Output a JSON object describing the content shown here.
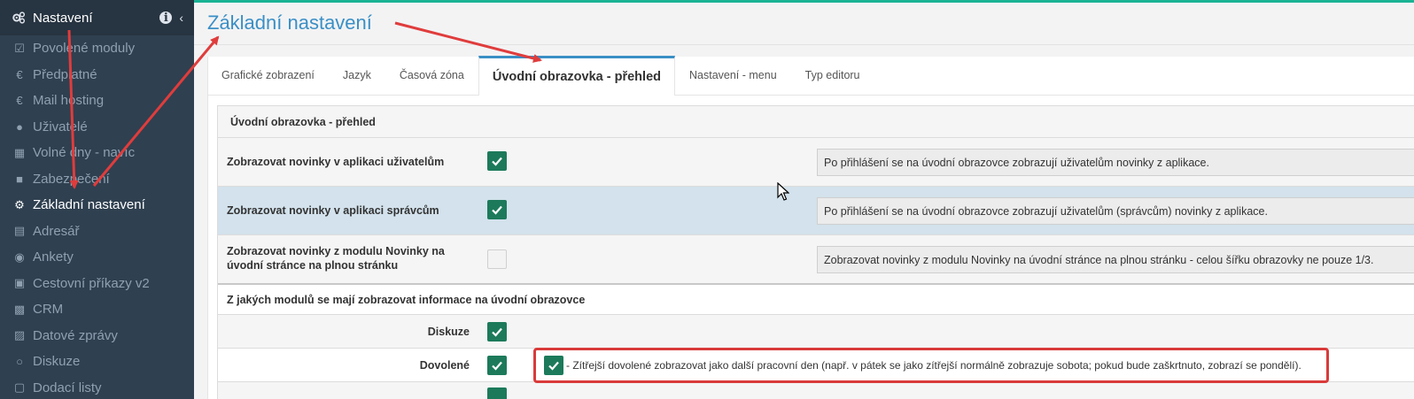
{
  "sidebar": {
    "header": {
      "label": "Nastavení",
      "icon": "gears-icon"
    },
    "items": [
      {
        "label": "Povolené moduly",
        "icon": "check-square-icon"
      },
      {
        "label": "Předplatné",
        "icon": "euro-icon"
      },
      {
        "label": "Mail hosting",
        "icon": "euro-icon"
      },
      {
        "label": "Uživatelé",
        "icon": "users-icon"
      },
      {
        "label": "Volné dny - navíc",
        "icon": "calendar-icon"
      },
      {
        "label": "Zabezpečení",
        "icon": "lock-icon"
      },
      {
        "label": "Základní nastavení",
        "icon": "gears-icon",
        "active": true
      },
      {
        "label": "Adresář",
        "icon": "book-icon"
      },
      {
        "label": "Ankety",
        "icon": "bullseye-icon"
      },
      {
        "label": "Cestovní příkazy v2",
        "icon": "bus-icon"
      },
      {
        "label": "CRM",
        "icon": "building-icon"
      },
      {
        "label": "Datové zprávy",
        "icon": "inbox-icon"
      },
      {
        "label": "Diskuze",
        "icon": "comments-icon"
      },
      {
        "label": "Dodací listy",
        "icon": "truck-icon"
      }
    ]
  },
  "page": {
    "title": "Základní nastavení"
  },
  "tabs": [
    {
      "label": "Grafické zobrazení"
    },
    {
      "label": "Jazyk"
    },
    {
      "label": "Časová zóna"
    },
    {
      "label": "Úvodní obrazovka - přehled",
      "active": true
    },
    {
      "label": "Nastavení - menu"
    },
    {
      "label": "Typ editoru"
    }
  ],
  "panel": {
    "title": "Úvodní obrazovka - přehled",
    "rows": [
      {
        "label": "Zobrazovat novinky v aplikaci uživatelům",
        "checked": true,
        "description": "Po přihlášení se na úvodní obrazovce zobrazují uživatelům novinky z aplikace."
      },
      {
        "label": "Zobrazovat novinky v aplikaci správcům",
        "checked": true,
        "description": "Po přihlášení se na úvodní obrazovce zobrazují uživatelům (správcům) novinky z aplikace."
      },
      {
        "label_line1": "Zobrazovat novinky z modulu Novinky na",
        "label_line2": "úvodní stránce na plnou stránku",
        "checked": false,
        "description": "Zobrazovat novinky z modulu Novinky na úvodní stránce na plnou stránku - celou šířku obrazovky ne pouze 1/3."
      }
    ],
    "modules_title": "Z jakých modulů se mají zobrazovat informace na úvodní obrazovce",
    "modules": [
      {
        "label": "Diskuze",
        "checked": true
      },
      {
        "label": "Dovolené",
        "checked": true,
        "extra": "- Zítřejší dovolené zobrazovat jako další pracovní den (např. v pátek se jako zítřejší normálně zobrazuje sobota; pokud bude zaškrtnuto, zobrazí se pondělí).",
        "extra_checked": true
      }
    ]
  },
  "colors": {
    "sidebar": "#2f4050",
    "accent": "#3a8fc6",
    "check": "#1c7a5a",
    "annotation": "#d93a3a",
    "highlight_row": "#d3e2ec"
  }
}
